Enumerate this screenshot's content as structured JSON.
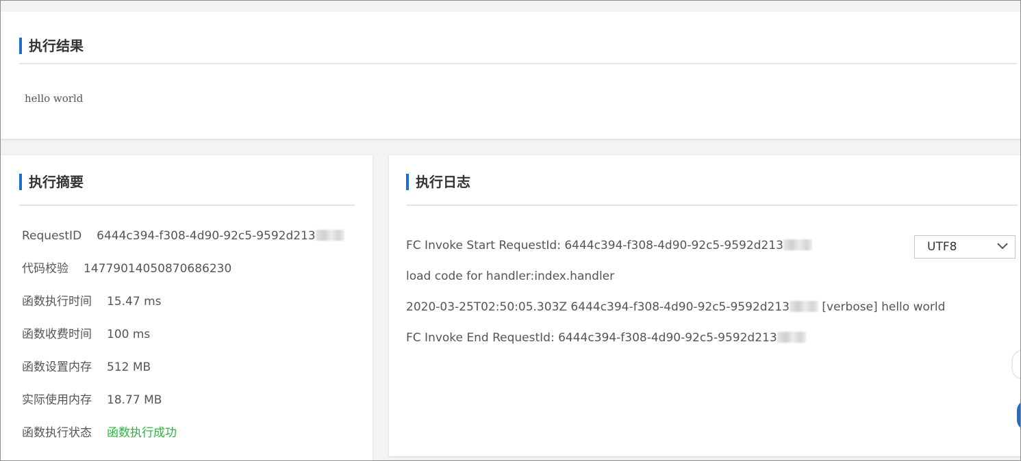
{
  "result_section": {
    "title": "执行结果",
    "output": "hello world"
  },
  "summary_section": {
    "title": "执行摘要",
    "rows": [
      {
        "label": "RequestID",
        "value": "6444c394-f308-4d90-92c5-9592d213",
        "blurred": true
      },
      {
        "label": "代码校验",
        "value": "14779014050870686230"
      },
      {
        "label": "函数执行时间",
        "value": "15.47 ms"
      },
      {
        "label": "函数收费时间",
        "value": "100 ms"
      },
      {
        "label": "函数设置内存",
        "value": "512 MB"
      },
      {
        "label": "实际使用内存",
        "value": "18.77 MB"
      },
      {
        "label": "函数执行状态",
        "value": "函数执行成功",
        "status_color": "#2bb341"
      }
    ]
  },
  "log_section": {
    "title": "执行日志",
    "encoding": {
      "selected": "UTF8"
    },
    "lines": [
      {
        "prefix": "FC Invoke Start RequestId: 6444c394-f308-4d90-92c5-9592d213",
        "suffix": ""
      },
      {
        "prefix": "load code for handler:index.handler",
        "suffix": ""
      },
      {
        "prefix": "2020-03-25T02:50:05.303Z 6444c394-f308-4d90-92c5-9592d213",
        "suffix": "[verbose] hello world"
      },
      {
        "prefix": "FC Invoke End RequestId: 6444c394-f308-4d90-92c5-9592d213",
        "suffix": ""
      }
    ]
  },
  "colors": {
    "accent": "#1b6fcb",
    "success": "#2bb341"
  }
}
